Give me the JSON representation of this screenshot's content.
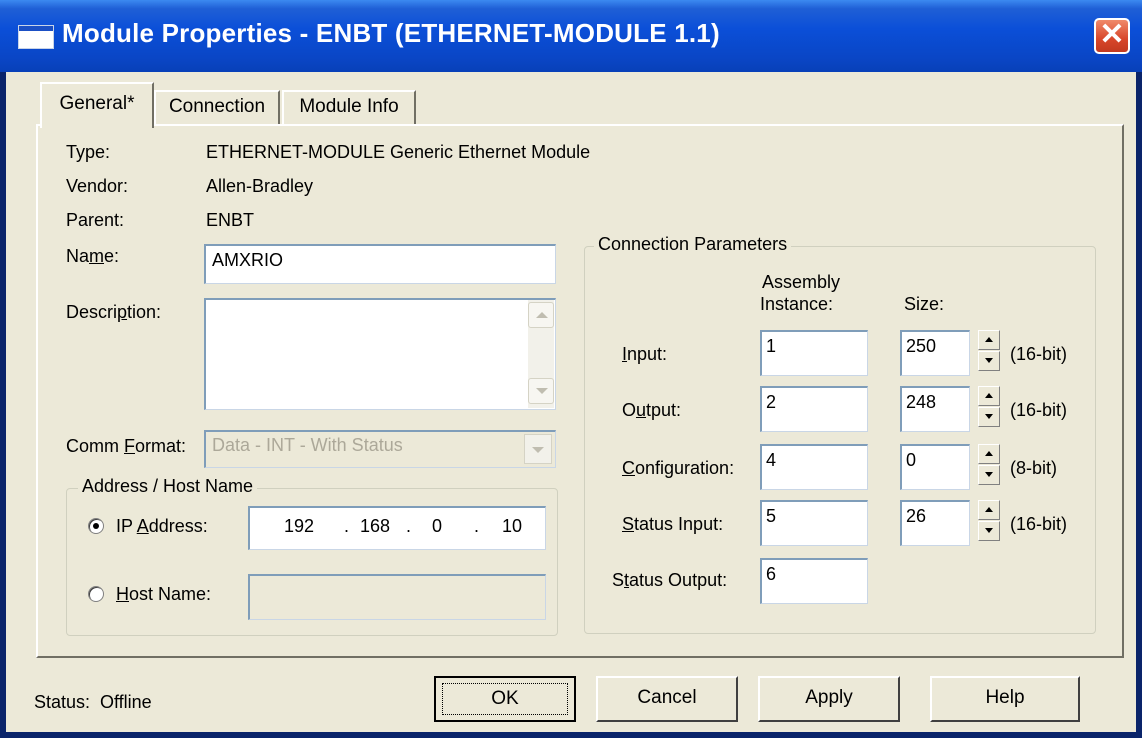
{
  "window": {
    "title": "Module Properties  - ENBT (ETHERNET-MODULE 1.1)",
    "close_symbol": "✕"
  },
  "tabs": [
    {
      "label": "General*",
      "active": true
    },
    {
      "label": "Connection",
      "active": false
    },
    {
      "label": "Module Info",
      "active": false
    }
  ],
  "general": {
    "type_label": "Type:",
    "type_value": "ETHERNET-MODULE Generic Ethernet Module",
    "vendor_label": "Vendor:",
    "vendor_value": "Allen-Bradley",
    "parent_label": "Parent:",
    "parent_value": "ENBT",
    "name_label_pre": "Na",
    "name_label_u": "m",
    "name_label_post": "e:",
    "name_value": "AMXRIO",
    "description_label_pre": "Descri",
    "description_label_u": "p",
    "description_label_post": "tion:",
    "description_value": "",
    "comm_label_pre": "Comm ",
    "comm_label_u": "F",
    "comm_label_post": "ormat:",
    "comm_value": "Data - INT - With Status"
  },
  "address": {
    "group_title": "Address / Host Name",
    "ip_label_pre": "IP ",
    "ip_label_u": "A",
    "ip_label_post": "ddress:",
    "ip_octets": [
      "192",
      "168",
      "0",
      "10"
    ],
    "ip_dot": ".",
    "ip_selected": true,
    "host_label_u": "H",
    "host_label_post": "ost Name:",
    "host_value": ""
  },
  "conn_params": {
    "group_title": "Connection Parameters",
    "col_assembly": "Assembly",
    "col_instance": "Instance:",
    "col_size": "Size:",
    "rows": [
      {
        "label_u": "I",
        "label_post": "nput:",
        "label_pre": "",
        "instance": "1",
        "size": "250",
        "unit": "(16-bit)"
      },
      {
        "label_pre": "O",
        "label_u": "u",
        "label_post": "tput:",
        "instance": "2",
        "size": "248",
        "unit": "(16-bit)"
      },
      {
        "label_pre": "",
        "label_u": "C",
        "label_post": "onfiguration:",
        "instance": "4",
        "size": "0",
        "unit": "(8-bit)"
      },
      {
        "label_pre": "",
        "label_u": "S",
        "label_post": "tatus Input:",
        "instance": "5",
        "size": "26",
        "unit": "(16-bit)"
      }
    ],
    "status_output_pre": "S",
    "status_output_u": "t",
    "status_output_post": "atus Output:",
    "status_output_instance": "6"
  },
  "footer": {
    "status_label": "Status:",
    "status_value": "Offline",
    "ok_label": "OK",
    "cancel_label": "Cancel",
    "apply_label": "Apply",
    "help_label": "Help"
  }
}
